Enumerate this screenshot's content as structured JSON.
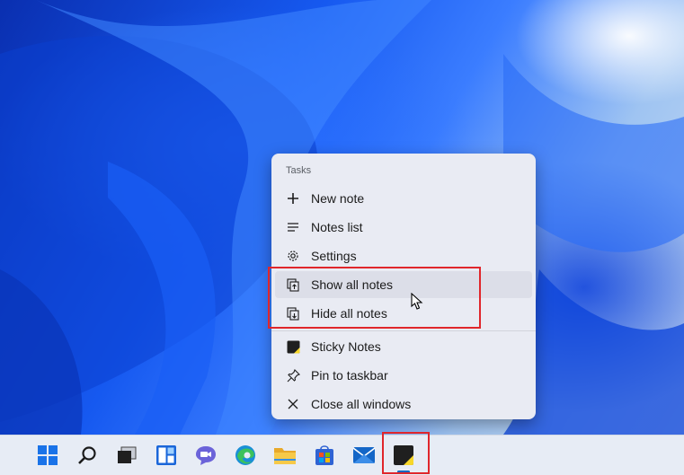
{
  "menu": {
    "header": "Tasks",
    "items": [
      {
        "label": "New note",
        "icon": "plus-icon"
      },
      {
        "label": "Notes list",
        "icon": "list-icon"
      },
      {
        "label": "Settings",
        "icon": "gear-icon"
      },
      {
        "label": "Show all notes",
        "icon": "show-notes-icon"
      },
      {
        "label": "Hide all notes",
        "icon": "hide-notes-icon"
      },
      {
        "label": "Sticky Notes",
        "icon": "sticky-notes-app-icon"
      },
      {
        "label": "Pin to taskbar",
        "icon": "pin-icon"
      },
      {
        "label": "Close all windows",
        "icon": "close-icon"
      }
    ]
  },
  "taskbar": {
    "icons": [
      "start-icon",
      "search-icon",
      "task-view-icon",
      "widgets-icon",
      "chat-icon",
      "edge-icon",
      "file-explorer-icon",
      "store-icon",
      "mail-icon",
      "sticky-notes-icon"
    ],
    "active": "sticky-notes-icon"
  },
  "colors": {
    "highlight": "#e0262b",
    "menu_bg": "#e9ebf3",
    "accent": "#0067c0"
  }
}
